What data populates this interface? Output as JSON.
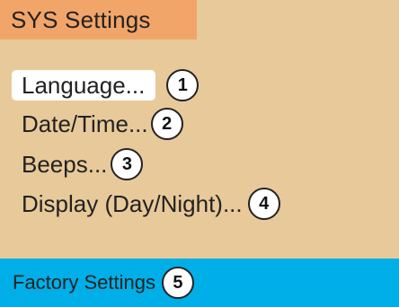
{
  "header": {
    "title": "SYS Settings"
  },
  "menu": {
    "items": [
      {
        "label": "Language...",
        "marker": "1",
        "selected": true
      },
      {
        "label": "Date/Time...",
        "marker": "2",
        "selected": false
      },
      {
        "label": "Beeps...",
        "marker": "3",
        "selected": false
      },
      {
        "label": "Display (Day/Night)...",
        "marker": "4",
        "selected": false
      }
    ]
  },
  "footer": {
    "label": "Factory Settings",
    "marker": "5"
  },
  "colors": {
    "background": "#e8c99a",
    "title_background": "#f2a569",
    "footer_background": "#00aee8",
    "selected_background": "#ffffff",
    "text": "#222222"
  }
}
